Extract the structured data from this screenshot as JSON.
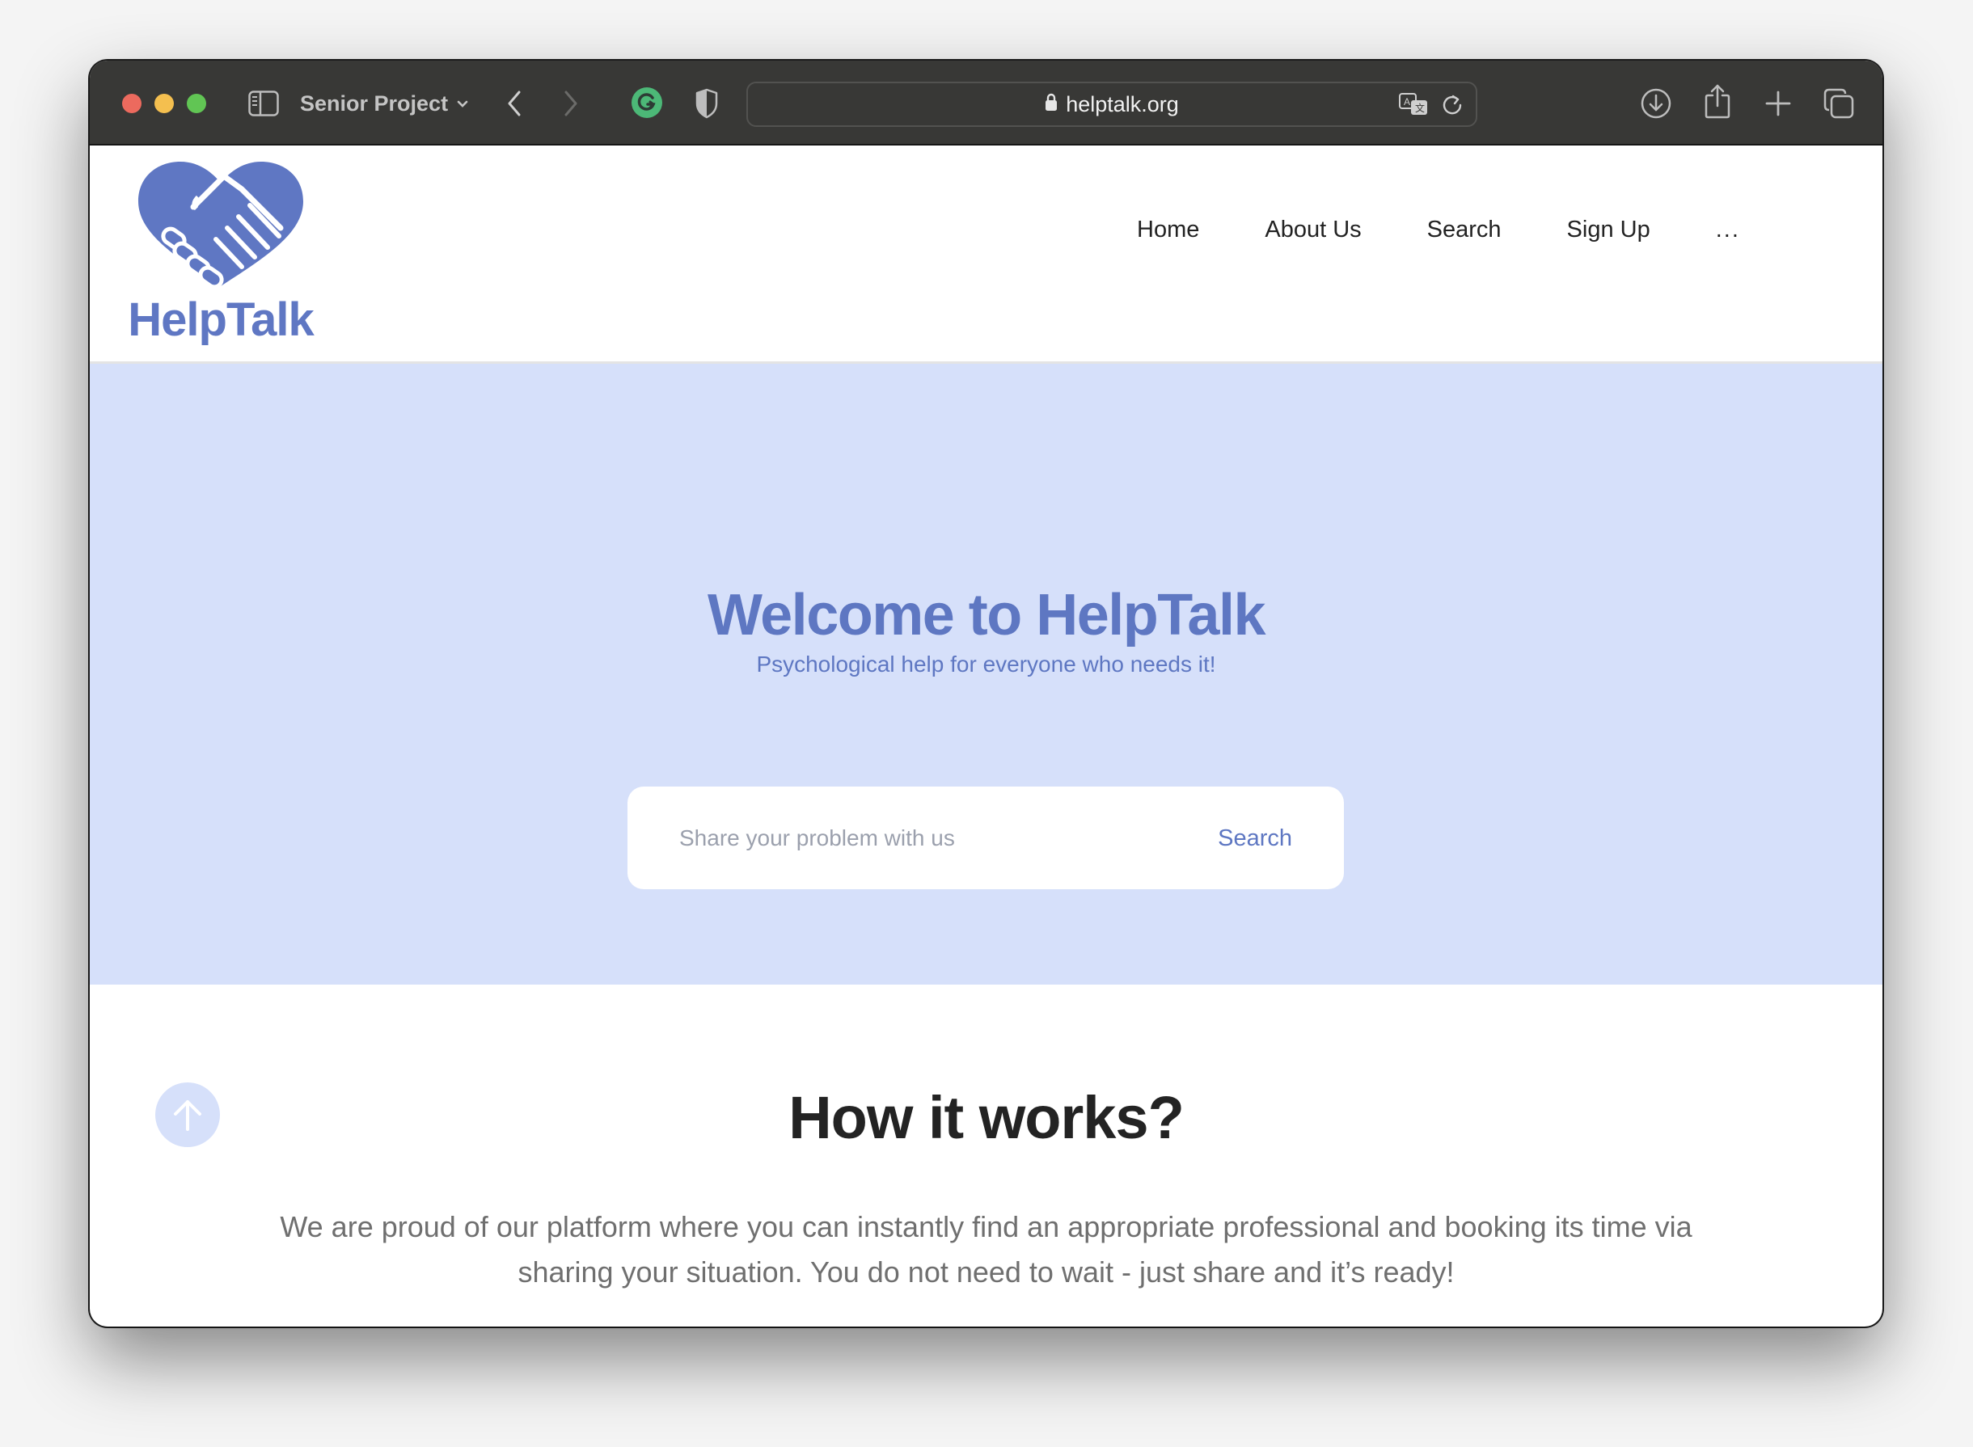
{
  "browser": {
    "tab_group_label": "Senior Project",
    "url": "helptalk.org",
    "icons": {
      "sidebar": "sidebar-icon",
      "back": "chevron-left-icon",
      "forward": "chevron-right-icon",
      "extension_1": "grammarly-icon",
      "extension_2": "shield-icon",
      "lock": "lock-icon",
      "translate": "translate-icon",
      "reload": "reload-icon",
      "download": "download-icon",
      "share": "share-icon",
      "new_tab": "plus-icon",
      "tab_overview": "tabs-icon"
    },
    "colors": {
      "titlebar": "#383836",
      "close": "#ec6a5e",
      "minimize": "#f4bf4f",
      "zoom": "#61c554",
      "grammarly": "#4cb877"
    }
  },
  "site": {
    "logo_text": "HelpTalk",
    "brand_color": "#5e77c2",
    "hero_bg": "#d6e0fa",
    "nav": [
      {
        "label": "Home"
      },
      {
        "label": "About Us"
      },
      {
        "label": "Search"
      },
      {
        "label": "Sign Up"
      },
      {
        "label": "..."
      }
    ],
    "hero": {
      "title": "Welcome to HelpTalk",
      "subtitle": "Psychological help for everyone who needs it!",
      "search_placeholder": "Share your problem with us",
      "search_value": "",
      "search_button": "Search"
    },
    "how_it_works": {
      "title": "How it works?",
      "text": "We are proud of our platform where you can instantly find an appropriate professional and booking its time via sharing your situation. You do not need to wait - just share and it’s ready!"
    },
    "scroll_top_icon": "arrow-up-icon"
  }
}
